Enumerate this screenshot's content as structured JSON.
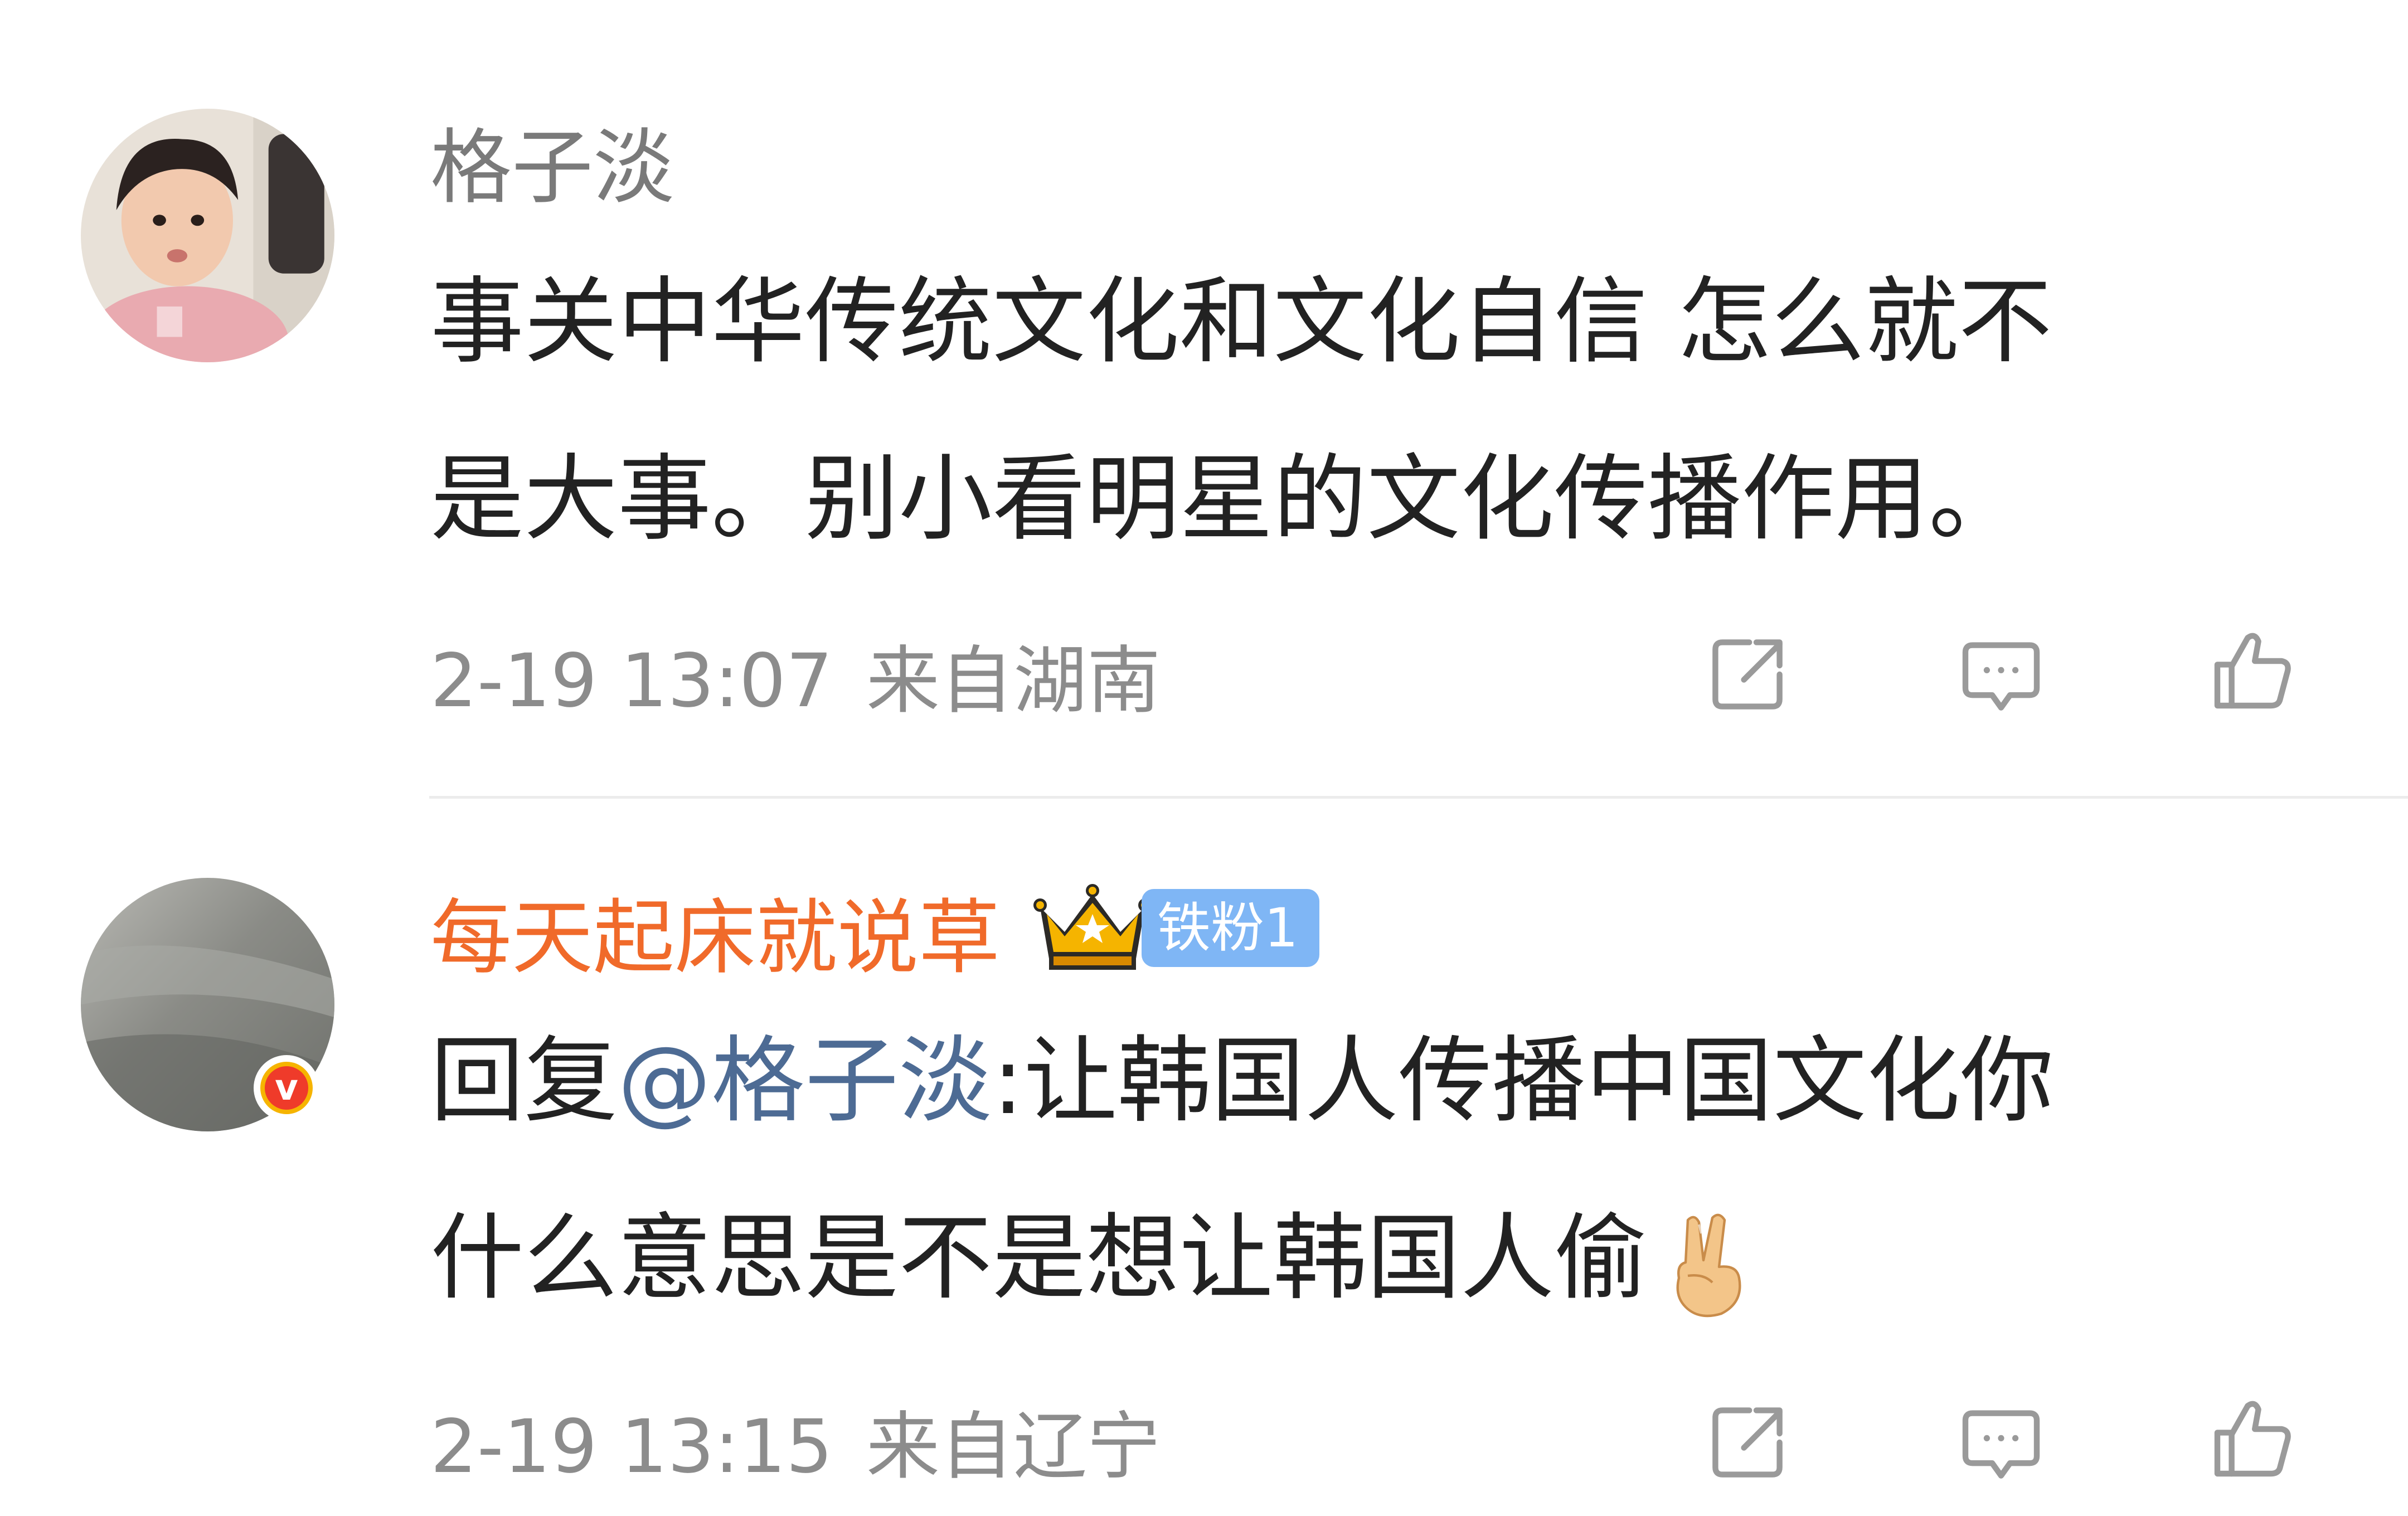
{
  "comments": [
    {
      "username": "格子淡",
      "username_color": "#7a7a7a",
      "body_lines": [
        "事关中华传统文化和文化自信 怎么就不",
        "是大事。别小看明星的文化传播作用。"
      ],
      "time": "2-19 13:07",
      "location": "来自湖南"
    },
    {
      "username": "每天起床就说草",
      "username_color": "#f06a2a",
      "fan_badge": "铁粉1",
      "reply_prefix": "回复",
      "mention": "@格子淡",
      "body_line1_rest": ":让韩国人传播中国文化你",
      "body_line2": "什么意思是不是想让韩国人偷",
      "time": "2-19 13:15",
      "location": "来自辽宁"
    }
  ],
  "icons": {
    "share": "share-icon",
    "comment": "comment-icon",
    "like": "thumbs-up-icon",
    "verified": "verified-v-badge",
    "crown": "crown-icon",
    "victory": "victory-hand-emoji"
  },
  "colors": {
    "text": "#222222",
    "meta": "#8c8c8c",
    "mention": "#4d6b94",
    "fan_badge": "#7fb6f5",
    "icon": "#9a9a9a"
  }
}
